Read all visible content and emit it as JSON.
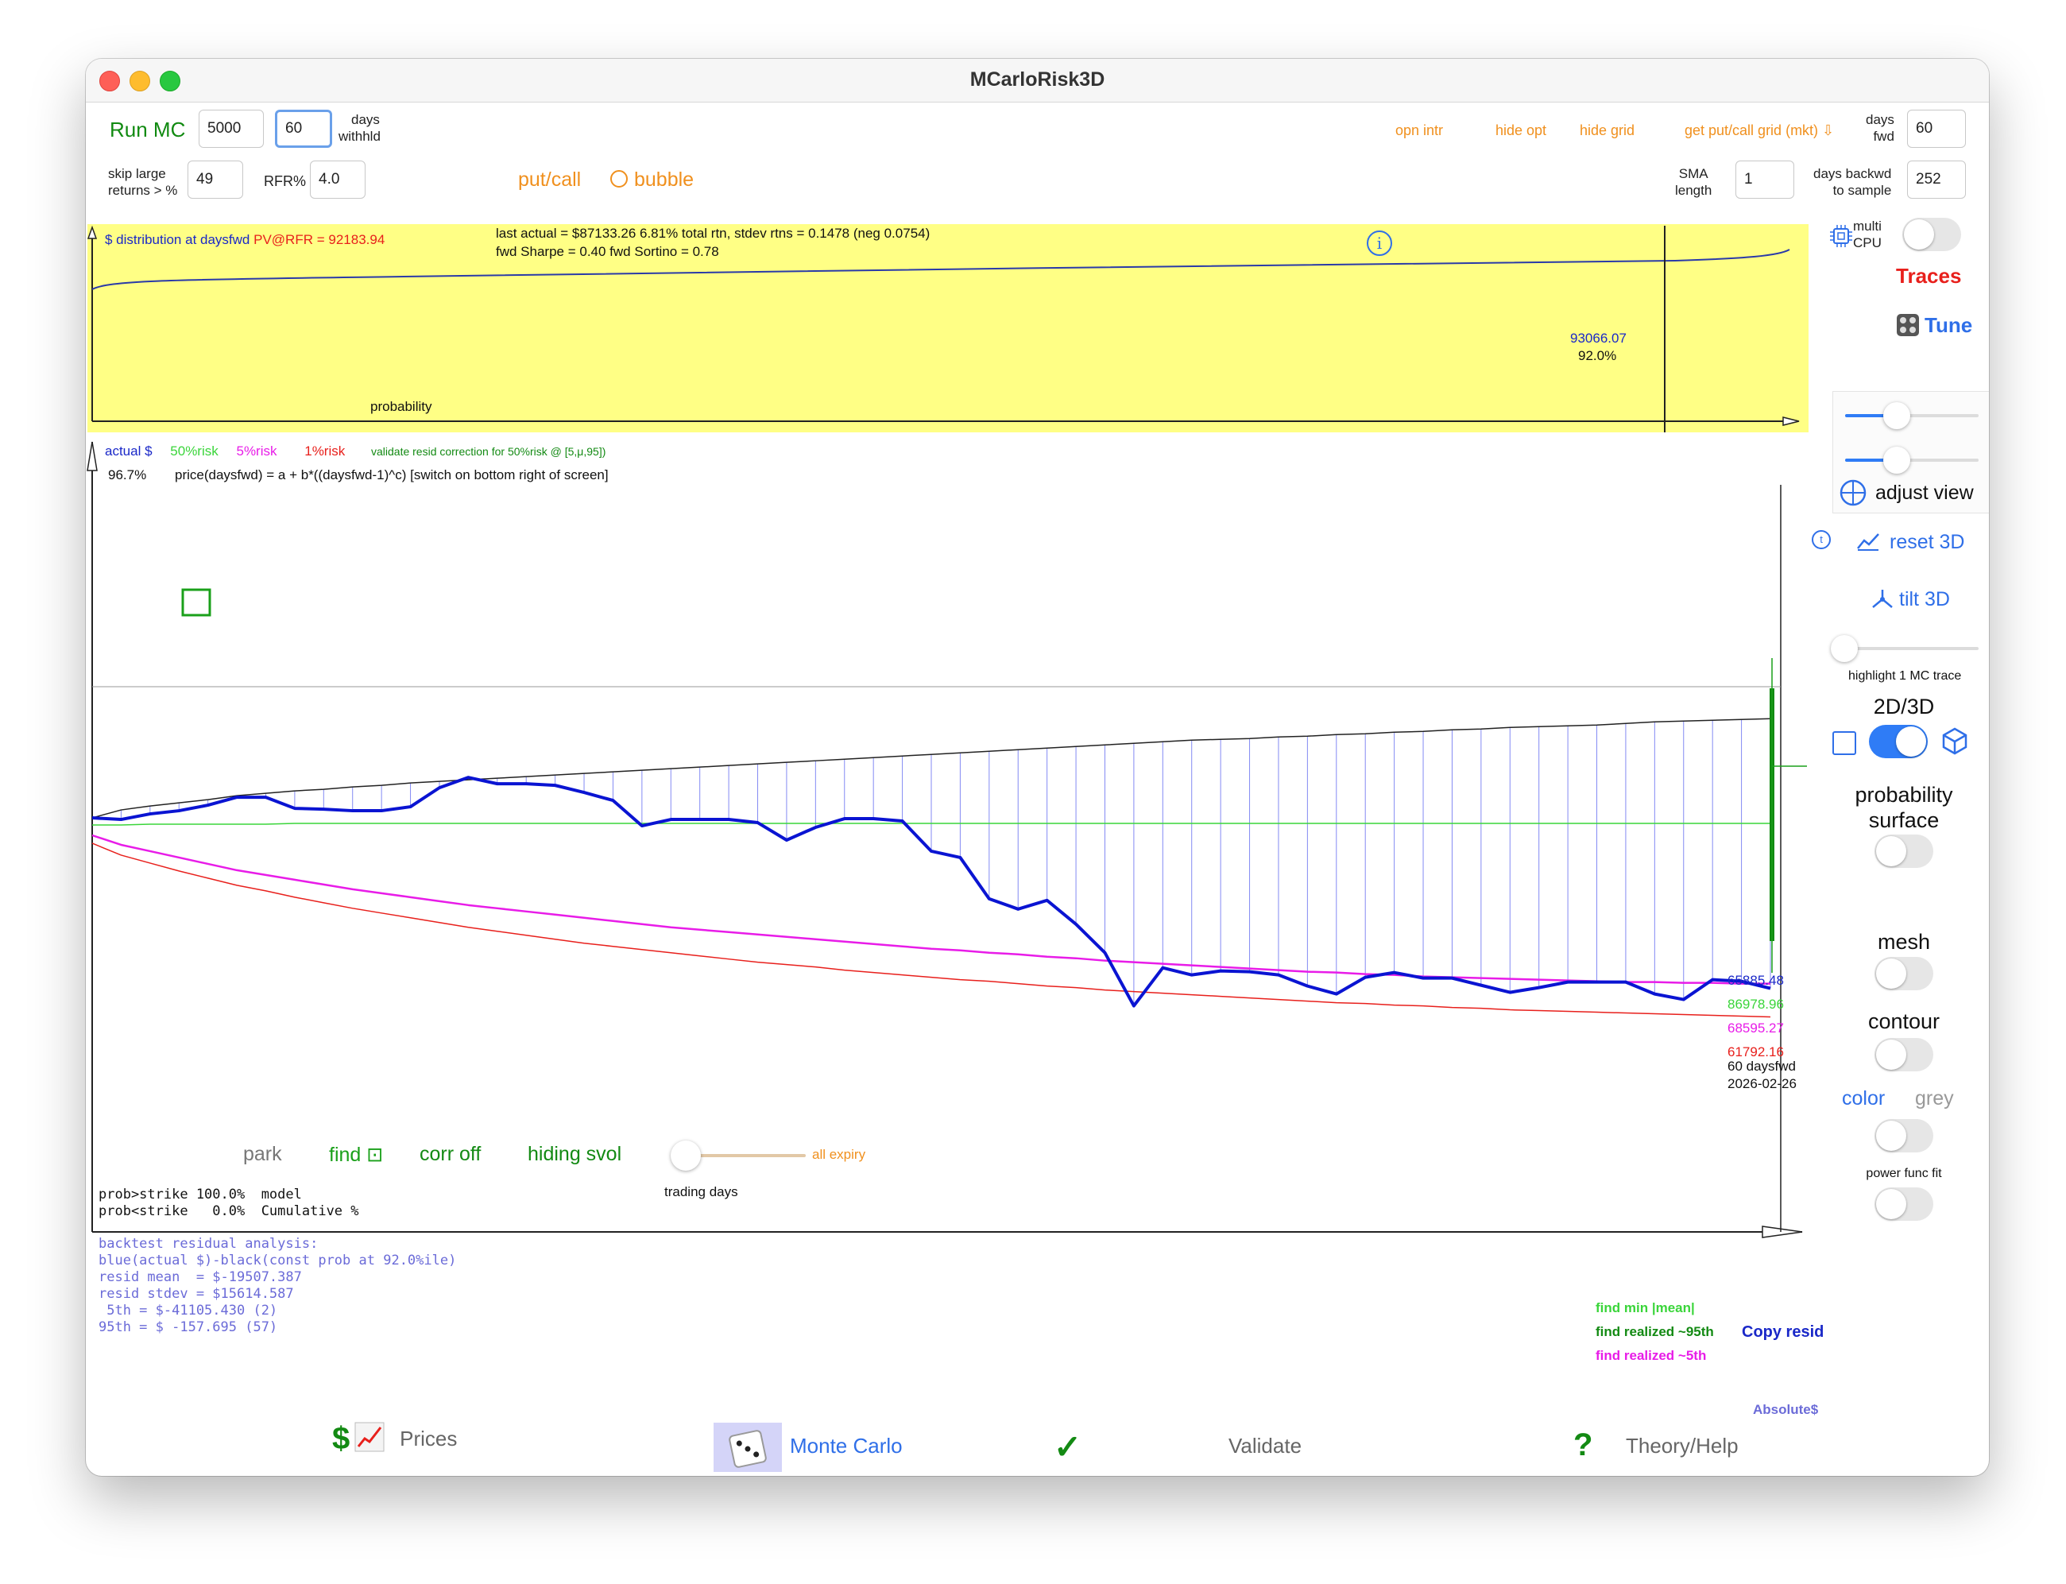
{
  "window": {
    "title": "MCarloRisk3D"
  },
  "toolbar": {
    "run_mc": "Run MC",
    "mc_count": "5000",
    "days_withheld": "60",
    "days_withheld_label_1": "days",
    "days_withheld_label_2": "withhld",
    "opn_intr": "opn intr",
    "hide_opt": "hide opt",
    "hide_grid": "hide grid",
    "get_put_call_grid": "get put/call grid (mkt) ⇩",
    "days_fwd_label_1": "days",
    "days_fwd_label_2": "fwd",
    "days_fwd": "60"
  },
  "toolbar2": {
    "skip_label_1": "skip large",
    "skip_label_2": "returns > %",
    "skip_value": "49",
    "rfr_label": "RFR%",
    "rfr_value": "4.0",
    "put_call": "put/call",
    "bubble": "bubble",
    "sma_label_1": "SMA",
    "sma_label_2": "length",
    "sma_value": "1",
    "days_back_label_1": "days backwd",
    "days_back_label_2": "to sample",
    "days_back_value": "252"
  },
  "dist_panel": {
    "title": "$ distribution at daysfwd",
    "pv": "PV@RFR = 92183.94",
    "stats_line1": "last actual = $87133.26   6.81% total rtn, stdev rtns = 0.1478 (neg 0.0754)",
    "stats_line2": "fwd Sharpe = 0.40 fwd Sortino = 0.78",
    "marker_value": "93066.07",
    "marker_pct": "92.0%",
    "xlabel": "probability"
  },
  "main_chart": {
    "legend_actual": "actual $",
    "legend_50": "50%risk",
    "legend_5": "5%risk",
    "legend_1": "1%risk",
    "validate_note": "validate resid correction for 50%risk @ [5,μ,95])",
    "pct": "96.7%",
    "formula": "price(daysfwd) = a + b*((daysfwd-1)^c) [switch on bottom right of screen]",
    "end_actual": "65885.48",
    "end_50": "86978.96",
    "end_5": "68595.27",
    "end_1": "61792.16",
    "end_daysfwd": "60 daysfwd",
    "end_date": "2026-02-26",
    "xlabel": "trading days",
    "park": "park",
    "find": "find ⊡",
    "corr_off": "corr off",
    "hiding_svol": "hiding svol",
    "all_expiry": "all expiry"
  },
  "chart_data": {
    "type": "line",
    "xlabel": "trading days",
    "series": [
      {
        "name": "actual $",
        "color": "#0a14d2",
        "values": [
          0.522,
          0.52,
          0.527,
          0.531,
          0.538,
          0.548,
          0.548,
          0.534,
          0.533,
          0.531,
          0.531,
          0.536,
          0.56,
          0.573,
          0.565,
          0.565,
          0.563,
          0.554,
          0.544,
          0.512,
          0.52,
          0.52,
          0.52,
          0.516,
          0.494,
          0.51,
          0.521,
          0.521,
          0.518,
          0.48,
          0.472,
          0.42,
          0.407,
          0.418,
          0.388,
          0.352,
          0.285,
          0.333,
          0.324,
          0.329,
          0.328,
          0.324,
          0.31,
          0.3,
          0.321,
          0.327,
          0.32,
          0.32,
          0.311,
          0.302,
          0.308,
          0.315,
          0.315,
          0.315,
          0.3,
          0.293,
          0.318,
          0.316,
          0.307
        ]
      },
      {
        "name": "50%risk",
        "color": "#3ad53a",
        "values": [
          0.513,
          0.513,
          0.514,
          0.514,
          0.514,
          0.514,
          0.514,
          0.515,
          0.515,
          0.515,
          0.515,
          0.515,
          0.515,
          0.515,
          0.515,
          0.515,
          0.515,
          0.515,
          0.515,
          0.515,
          0.515,
          0.515,
          0.515,
          0.515,
          0.515,
          0.515,
          0.515,
          0.515,
          0.515,
          0.515,
          0.515,
          0.515,
          0.515,
          0.515,
          0.515,
          0.515,
          0.515,
          0.515,
          0.515,
          0.515,
          0.515,
          0.515,
          0.515,
          0.515,
          0.515,
          0.515,
          0.515,
          0.515,
          0.515,
          0.515,
          0.515,
          0.515,
          0.515,
          0.515,
          0.515,
          0.515,
          0.515,
          0.515,
          0.515
        ]
      },
      {
        "name": "5%risk",
        "color": "#e81ce8",
        "values": [
          0.5,
          0.488,
          0.48,
          0.472,
          0.464,
          0.456,
          0.45,
          0.444,
          0.438,
          0.432,
          0.427,
          0.422,
          0.417,
          0.412,
          0.408,
          0.404,
          0.4,
          0.396,
          0.392,
          0.388,
          0.384,
          0.381,
          0.378,
          0.375,
          0.372,
          0.369,
          0.366,
          0.363,
          0.36,
          0.357,
          0.355,
          0.352,
          0.35,
          0.347,
          0.345,
          0.342,
          0.34,
          0.338,
          0.336,
          0.334,
          0.332,
          0.33,
          0.328,
          0.327,
          0.325,
          0.324,
          0.322,
          0.321,
          0.32,
          0.319,
          0.318,
          0.317,
          0.316,
          0.315,
          0.315,
          0.314,
          0.314,
          0.313,
          0.313
        ]
      },
      {
        "name": "1%risk",
        "color": "#e8201c",
        "values": [
          0.49,
          0.475,
          0.465,
          0.455,
          0.446,
          0.437,
          0.43,
          0.422,
          0.415,
          0.408,
          0.402,
          0.396,
          0.39,
          0.384,
          0.379,
          0.374,
          0.369,
          0.364,
          0.36,
          0.356,
          0.352,
          0.348,
          0.344,
          0.34,
          0.337,
          0.334,
          0.33,
          0.327,
          0.324,
          0.321,
          0.318,
          0.316,
          0.313,
          0.31,
          0.308,
          0.305,
          0.303,
          0.301,
          0.299,
          0.297,
          0.295,
          0.293,
          0.291,
          0.289,
          0.288,
          0.286,
          0.285,
          0.283,
          0.282,
          0.28,
          0.279,
          0.278,
          0.277,
          0.276,
          0.275,
          0.274,
          0.273,
          0.272,
          0.271
        ]
      },
      {
        "name": "upper",
        "color": "#222222",
        "values": [
          0.522,
          0.532,
          0.537,
          0.541,
          0.545,
          0.55,
          0.553,
          0.556,
          0.558,
          0.561,
          0.563,
          0.566,
          0.568,
          0.57,
          0.572,
          0.574,
          0.576,
          0.578,
          0.58,
          0.582,
          0.584,
          0.586,
          0.588,
          0.59,
          0.592,
          0.594,
          0.596,
          0.598,
          0.6,
          0.602,
          0.604,
          0.606,
          0.608,
          0.61,
          0.612,
          0.614,
          0.616,
          0.618,
          0.62,
          0.621,
          0.622,
          0.624,
          0.625,
          0.627,
          0.628,
          0.63,
          0.631,
          0.633,
          0.634,
          0.636,
          0.637,
          0.638,
          0.639,
          0.641,
          0.643,
          0.644,
          0.645,
          0.646,
          0.647
        ]
      }
    ]
  },
  "stats_text": {
    "l1": "prob>strike 100.0%  model",
    "l2": "prob<strike   0.0%  Cumulative %",
    "b1": "backtest residual analysis:",
    "b2": "blue(actual $)-black(const prob at 92.0%ile)",
    "b3": "resid mean  = $-19507.387",
    "b4": "resid stdev = $15614.587",
    "b5": " 5th = $-41105.430 (2)",
    "b6": "95th = $ -157.695 (57)"
  },
  "bottom_right": {
    "find_min": "find min |mean|",
    "find_95": "find realized ~95th",
    "copy_resid": "Copy resid",
    "find_5": "find realized ~5th",
    "absolute": "Absolute$"
  },
  "sidebar": {
    "multi_cpu_1": "multi",
    "multi_cpu_2": "CPU",
    "traces": "Traces",
    "tune": "Tune",
    "adjust_view": "adjust view",
    "reset_3d": "reset 3D",
    "tilt_3d": "tilt 3D",
    "highlight": "highlight 1 MC trace",
    "mode": "2D/3D",
    "prob_surface_1": "probability",
    "prob_surface_2": "surface",
    "mesh": "mesh",
    "contour": "contour",
    "color": "color",
    "grey": "grey",
    "power_fit": "power func fit"
  },
  "tabs": {
    "prices": "Prices",
    "monte_carlo": "Monte Carlo",
    "validate": "Validate",
    "theory": "Theory/Help"
  }
}
